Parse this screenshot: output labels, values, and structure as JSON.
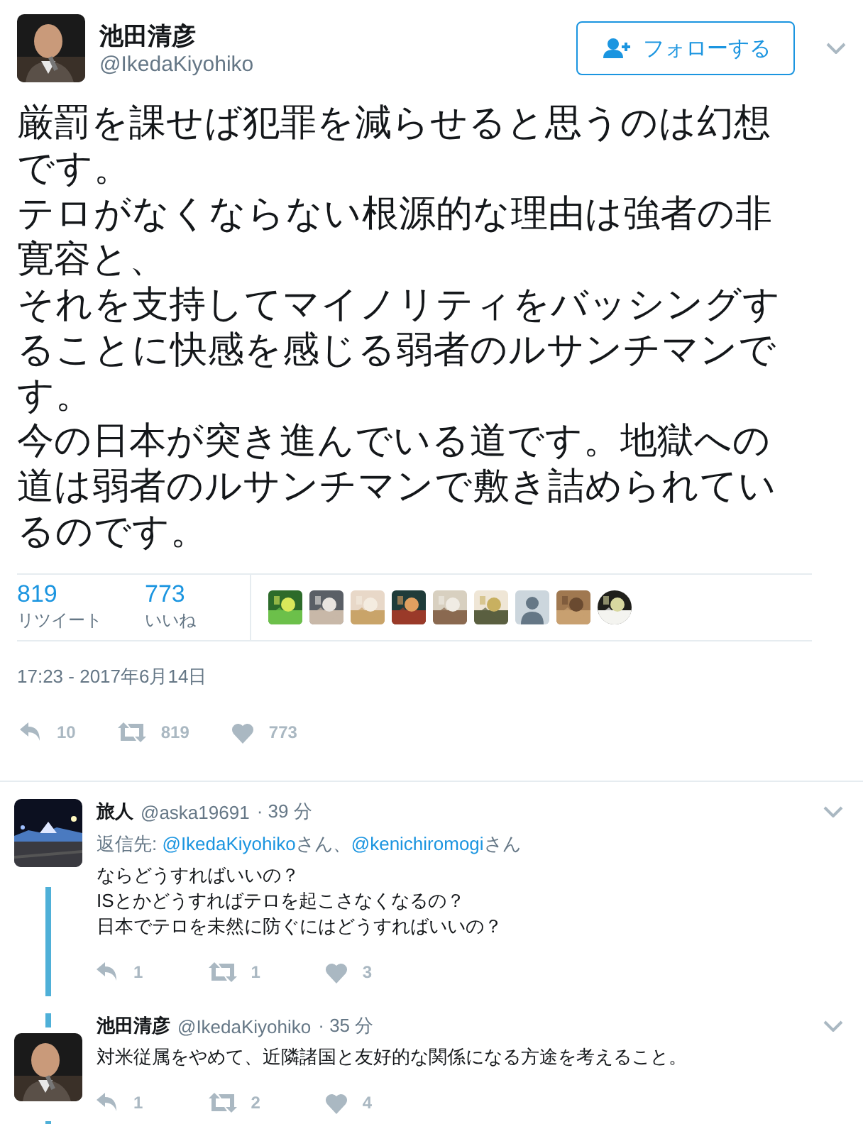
{
  "tweet": {
    "name": "池田清彦",
    "handle": "@IkedaKiyohiko",
    "follow_label": "フォローする",
    "paragraphs": [
      "厳罰を課せば犯罪を減らせると思うのは幻想です。",
      "テロがなくならない根源的な理由は強者の非寛容と、",
      "それを支持してマイノリティをバッシングすることに快感を感じる弱者のルサンチマンです。",
      "今の日本が突き進んでいる道です。地獄への道は弱者のルサンチマンで敷き詰められているのです。"
    ],
    "stats": [
      {
        "count": "819",
        "label": "リツイート"
      },
      {
        "count": "773",
        "label": "いいね"
      }
    ],
    "likers": [
      {
        "kind": "picture"
      },
      {
        "kind": "picture"
      },
      {
        "kind": "picture"
      },
      {
        "kind": "picture"
      },
      {
        "kind": "picture"
      },
      {
        "kind": "picture"
      },
      {
        "kind": "default"
      },
      {
        "kind": "picture"
      },
      {
        "kind": "picture"
      }
    ],
    "timestamp": "17:23 - 2017年6月14日",
    "actions": {
      "reply": "10",
      "retweet": "819",
      "like": "773"
    }
  },
  "replies": [
    {
      "name": "旅人",
      "handle": "@aska19691",
      "time": "· 39 分",
      "reply_prefix": "返信先:",
      "reply_to": [
        {
          "handle": "@IkedaKiyohiko",
          "suffix": "さん、"
        },
        {
          "handle": "@kenichiromogi",
          "suffix": "さん"
        }
      ],
      "lines": [
        "ならどうすればいいの？",
        "ISとかどうすればテロを起こさなくなるの？",
        "日本でテロを未然に防ぐにはどうすればいいの？"
      ],
      "actions": {
        "reply": "1",
        "retweet": "1",
        "like": "3"
      }
    },
    {
      "name": "池田清彦",
      "handle": "@IkedaKiyohiko",
      "time": "· 35 分",
      "lines": [
        "対米従属をやめて、近隣諸国と友好的な関係になる方途を考えること。"
      ],
      "actions": {
        "reply": "1",
        "retweet": "2",
        "like": "4"
      }
    }
  ]
}
